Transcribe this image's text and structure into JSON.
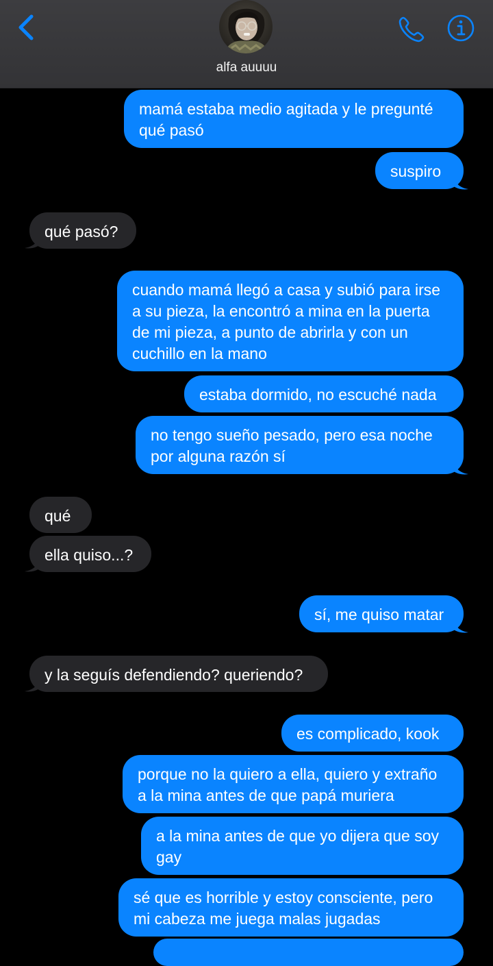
{
  "header": {
    "contact_name": "alfa auuuu",
    "back_icon": "chevron-left-icon",
    "call_icon": "phone-icon",
    "info_icon": "info-icon",
    "accent_color": "#0a84ff"
  },
  "messages": [
    {
      "direction": "outgoing",
      "text": "mamá estaba medio agitada y le pregunté qué pasó"
    },
    {
      "direction": "outgoing",
      "text": "suspiro"
    },
    {
      "direction": "incoming",
      "text": "qué pasó?"
    },
    {
      "direction": "outgoing",
      "text": "cuando mamá llegó a casa y subió para irse a su pieza, la encontró a mina en la puerta de mi pieza, a punto de abrirla y con un cuchillo en la mano"
    },
    {
      "direction": "outgoing",
      "text": "estaba dormido, no escuché nada"
    },
    {
      "direction": "outgoing",
      "text": "no tengo sueño pesado, pero esa noche por alguna razón sí"
    },
    {
      "direction": "incoming",
      "text": "qué"
    },
    {
      "direction": "incoming",
      "text": "ella quiso...?"
    },
    {
      "direction": "outgoing",
      "text": "sí, me quiso matar"
    },
    {
      "direction": "incoming",
      "text": "y la seguís defendiendo? queriendo?"
    },
    {
      "direction": "outgoing",
      "text": "es complicado, kook"
    },
    {
      "direction": "outgoing",
      "text": "porque no la quiero a ella, quiero y extraño a la mina antes de que papá muriera"
    },
    {
      "direction": "outgoing",
      "text": "a la mina antes de que yo dijera que soy gay"
    },
    {
      "direction": "outgoing",
      "text": "sé que es horrible y estoy consciente, pero mi cabeza me juega malas jugadas"
    }
  ]
}
